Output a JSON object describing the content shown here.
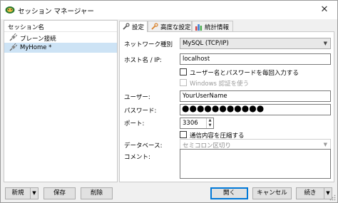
{
  "window": {
    "title": "セッション マネージャー"
  },
  "sessions": {
    "header_label": "セッション名",
    "items": [
      {
        "label": "プレーン接続"
      },
      {
        "label": "MyHome *"
      }
    ]
  },
  "tabs": [
    {
      "label": "設定"
    },
    {
      "label": "高度な設定"
    },
    {
      "label": "統計情報"
    }
  ],
  "form": {
    "network_type": {
      "label": "ネットワーク種別",
      "value": "MySQL (TCP/IP)"
    },
    "host": {
      "label": "ホスト名 / IP:",
      "value": "localhost"
    },
    "prompt_credentials": {
      "label": "ユーザー名とパスワードを毎回入力する",
      "checked": false
    },
    "windows_auth": {
      "label": "Windows 認証を使う",
      "checked": false,
      "disabled": true
    },
    "user": {
      "label": "ユーザー:",
      "value": "YourUserName"
    },
    "password": {
      "label": "パスワード:",
      "masked": "●●●●●●●●●●●"
    },
    "port": {
      "label": "ポート:",
      "value": "3306"
    },
    "compress": {
      "label": "通信内容を圧縮する",
      "checked": false
    },
    "databases": {
      "label": "データベース:",
      "placeholder": "セミコロン区切り"
    },
    "comment": {
      "label": "コメント:",
      "value": ""
    }
  },
  "buttons": {
    "new": "新規",
    "save": "保存",
    "delete": "削除",
    "open": "開く",
    "cancel": "キャンセル",
    "more": "続き"
  },
  "colors": {
    "selection": "#cde3f5",
    "accent": "#0078d7",
    "window_bg": "#f0f0f0"
  }
}
